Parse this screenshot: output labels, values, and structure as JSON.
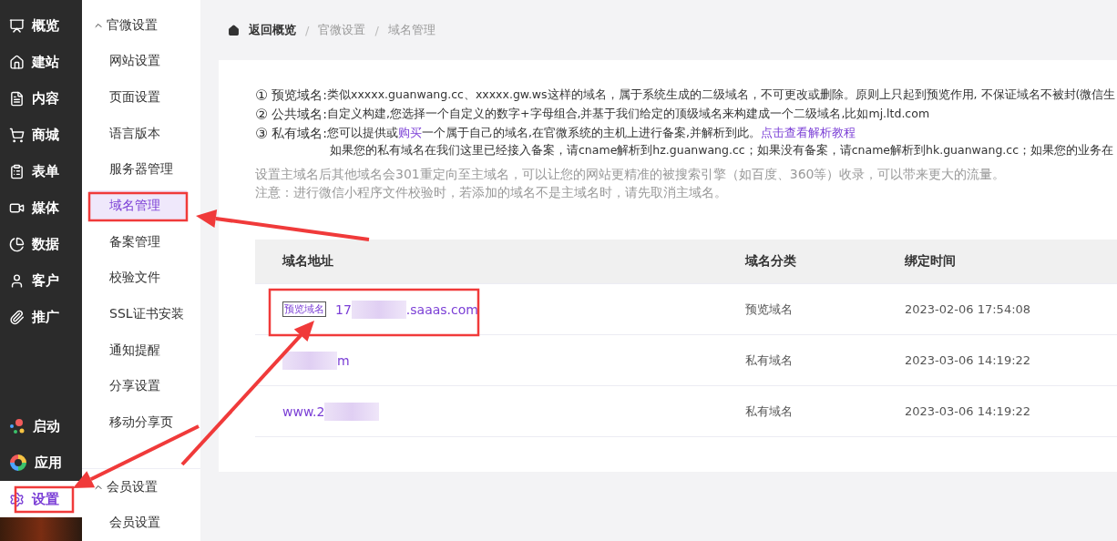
{
  "main_nav": [
    {
      "label": "概览",
      "selected": false
    },
    {
      "label": "建站",
      "selected": false
    },
    {
      "label": "内容",
      "selected": false
    },
    {
      "label": "商城",
      "selected": false
    },
    {
      "label": "表单",
      "selected": false
    },
    {
      "label": "媒体",
      "selected": false
    },
    {
      "label": "数据",
      "selected": false
    },
    {
      "label": "客户",
      "selected": false
    },
    {
      "label": "推广",
      "selected": false
    }
  ],
  "main_nav_bottom": [
    {
      "label": "启动",
      "selected": false
    },
    {
      "label": "应用",
      "selected": false
    },
    {
      "label": "设置",
      "selected": true
    }
  ],
  "sub_nav": [
    {
      "title": "官微设置",
      "expanded": true,
      "items": [
        {
          "label": "网站设置",
          "selected": false
        },
        {
          "label": "页面设置",
          "selected": false
        },
        {
          "label": "语言版本",
          "selected": false
        },
        {
          "label": "服务器管理",
          "selected": false
        },
        {
          "label": "域名管理",
          "selected": true
        },
        {
          "label": "备案管理",
          "selected": false
        },
        {
          "label": "校验文件",
          "selected": false
        },
        {
          "label": "SSL证书安装",
          "selected": false
        },
        {
          "label": "通知提醒",
          "selected": false
        },
        {
          "label": "分享设置",
          "selected": false
        },
        {
          "label": "移动分享页",
          "selected": false
        }
      ]
    },
    {
      "title": "会员设置",
      "expanded": true,
      "items": [
        {
          "label": "会员设置",
          "selected": false
        }
      ]
    }
  ],
  "breadcrumb": {
    "separator": "/",
    "items": [
      "返回概览",
      "官微设置",
      "域名管理"
    ]
  },
  "notes": [
    {
      "number": "①",
      "label": "预览域名:",
      "segments": [
        {
          "kind": "plain",
          "text": "类似xxxxx.guanwang.cc、xxxxx.gw.ws这样的域名，属于系统生成的二级域名，不可更改或删除。原则上只起到预览作用, 不保证域名不被封(微信生"
        }
      ]
    },
    {
      "number": "②",
      "label": "公共域名:",
      "segments": [
        {
          "kind": "plain",
          "text": "自定义构建,您选择一个自定义的数字+字母组合,并基于我们给定的顶级域名来构建成一个二级域名,比如mj.ltd.com"
        }
      ]
    },
    {
      "number": "③",
      "label": "私有域名:",
      "segments": [
        {
          "kind": "plain",
          "text": "您可以提供或"
        },
        {
          "kind": "link",
          "text": "购买"
        },
        {
          "kind": "plain",
          "text": "一个属于自己的域名,在官微系统的主机上进行备案,并解析到此。"
        },
        {
          "kind": "link",
          "text": "点击查看解析教程"
        }
      ],
      "subline": "如果您的私有域名在我们这里已经接入备案，请cname解析到hz.guanwang.cc；如果没有备案，请cname解析到hk.guanwang.cc；如果您的业务在"
    }
  ],
  "hints": [
    "设置主域名后其他域名会301重定向至主域名，可以让您的网站更精准的被搜索引擎（如百度、360等）收录，可以带来更大的流量。",
    "注意：进行微信小程序文件校验时，若添加的域名不是主域名时，请先取消主域名。"
  ],
  "table": {
    "columns": [
      "域名地址",
      "域名分类",
      "绑定时间"
    ],
    "rows": [
      {
        "tag": "预览域名",
        "domain_start": "17",
        "domain_end": ".saaas.com",
        "category": "预览域名",
        "time": "2023-02-06 17:54:08"
      },
      {
        "domain_start": "",
        "domain_end": "m",
        "category": "私有域名",
        "time": "2023-03-06 14:19:22"
      },
      {
        "domain_start": "www.2",
        "domain_end": "",
        "category": "私有域名",
        "time": "2023-03-06 14:19:22"
      }
    ]
  }
}
